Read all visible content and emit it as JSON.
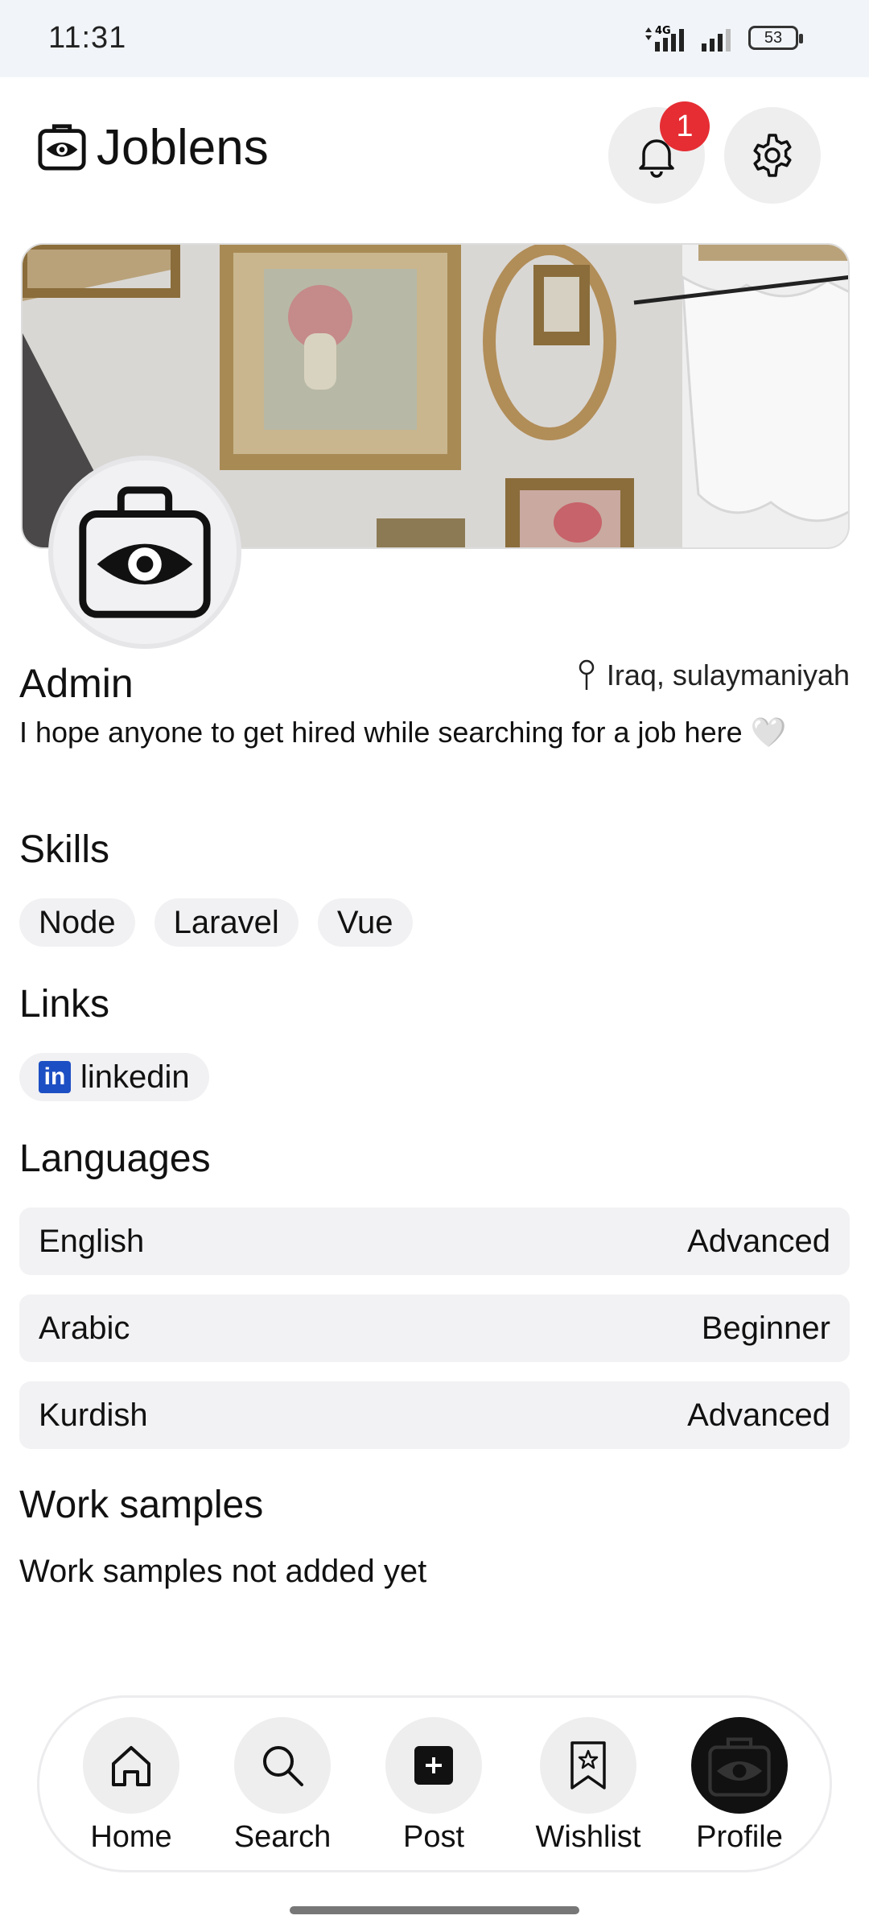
{
  "status_bar": {
    "time": "11:31",
    "battery": "53"
  },
  "header": {
    "app_name": "Joblens",
    "notification_count": "1"
  },
  "profile": {
    "name": "Admin",
    "location": "Iraq, sulaymaniyah",
    "bio": "I hope anyone to get hired while searching for a job here 🤍"
  },
  "skills": {
    "title": "Skills",
    "items": [
      "Node",
      "Laravel",
      "Vue"
    ]
  },
  "links": {
    "title": "Links",
    "items": [
      {
        "label": "linkedin",
        "icon": "linkedin-icon",
        "brand_color": "#1d4fc4"
      }
    ]
  },
  "languages": {
    "title": "Languages",
    "items": [
      {
        "name": "English",
        "level": "Advanced"
      },
      {
        "name": "Arabic",
        "level": "Beginner"
      },
      {
        "name": "Kurdish",
        "level": "Advanced"
      }
    ]
  },
  "work_samples": {
    "title": "Work samples",
    "empty_text": "Work samples not added yet"
  },
  "bottom_nav": {
    "items": [
      {
        "label": "Home",
        "icon": "home-icon"
      },
      {
        "label": "Search",
        "icon": "search-icon"
      },
      {
        "label": "Post",
        "icon": "plus-square-icon"
      },
      {
        "label": "Wishlist",
        "icon": "bookmark-star-icon"
      },
      {
        "label": "Profile",
        "icon": "avatar-icon",
        "active": true
      }
    ]
  },
  "colors": {
    "badge": "#e52d33",
    "chip_bg": "#f1f1f3",
    "status_bar_bg": "#f1f5f9",
    "linkedin": "#1d4fc4"
  }
}
